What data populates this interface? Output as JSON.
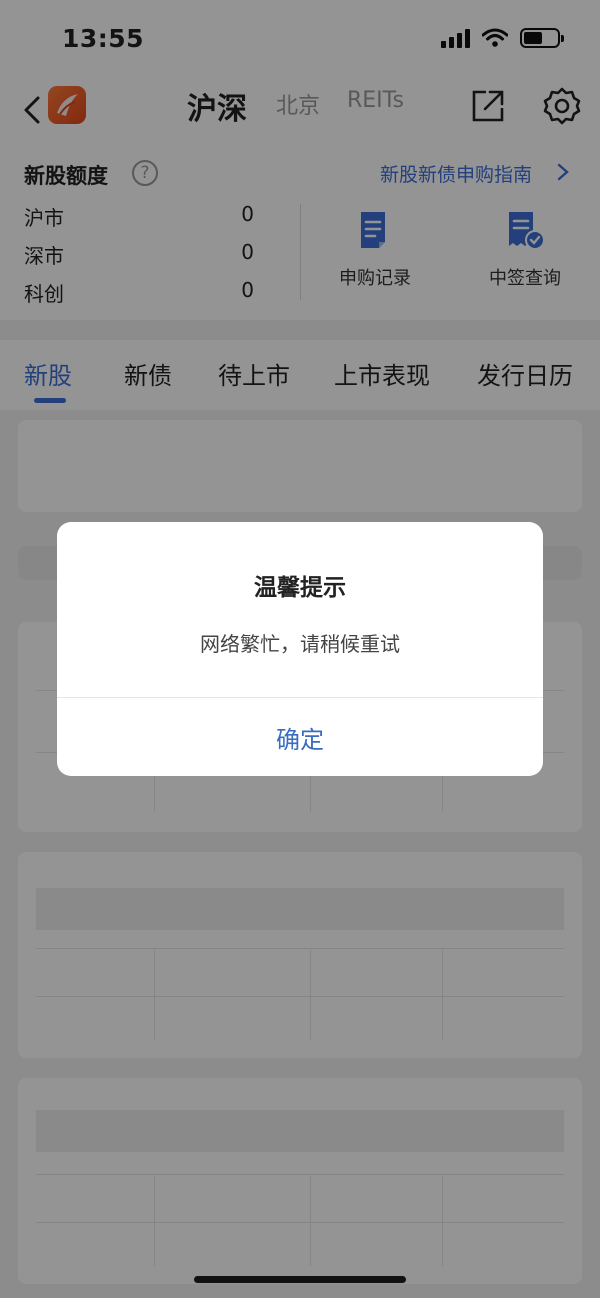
{
  "status_bar": {
    "time": "13:55"
  },
  "header": {
    "tabs": [
      {
        "label": "沪深",
        "active": true
      },
      {
        "label": "北京",
        "active": false
      },
      {
        "label": "REITs",
        "active": false
      }
    ]
  },
  "quota": {
    "title": "新股额度",
    "help_symbol": "?",
    "guide_link": "新股新债申购指南",
    "rows": [
      {
        "market": "沪市",
        "value": "0"
      },
      {
        "market": "深市",
        "value": "0"
      },
      {
        "market": "科创",
        "value": "0"
      }
    ],
    "tools": [
      {
        "label": "申购记录",
        "icon": "document-icon"
      },
      {
        "label": "中签查询",
        "icon": "receipt-check-icon"
      }
    ]
  },
  "tabs": [
    {
      "label": "新股",
      "active": true
    },
    {
      "label": "新债",
      "active": false
    },
    {
      "label": "待上市",
      "active": false
    },
    {
      "label": "上市表现",
      "active": false
    },
    {
      "label": "发行日历",
      "active": false
    }
  ],
  "dialog": {
    "title": "温馨提示",
    "message": "网络繁忙，请稍候重试",
    "confirm_label": "确定"
  },
  "colors": {
    "accent": "#3d6fd8",
    "overlay": "rgba(0,0,0,0.42)",
    "logo": "#ff7a3a"
  }
}
